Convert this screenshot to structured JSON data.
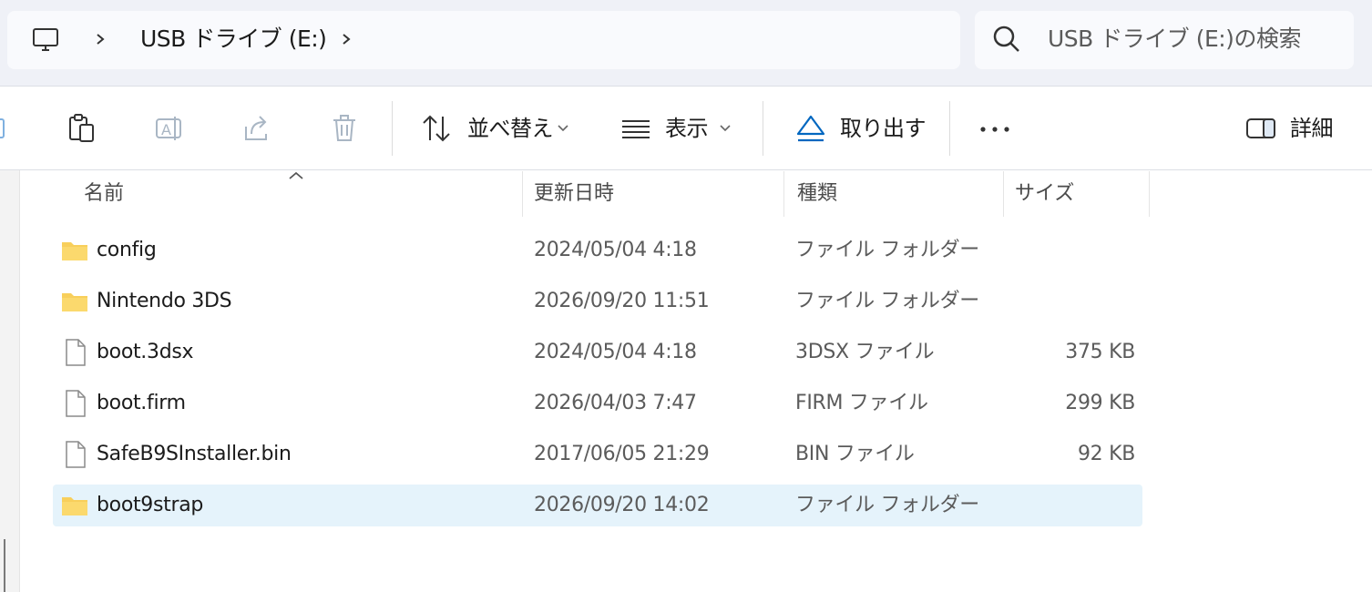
{
  "address": {
    "crumbs": [
      "USB ドライブ (E:)"
    ]
  },
  "search": {
    "placeholder": "USB ドライブ (E:)の検索"
  },
  "toolbar": {
    "sort_label": "並べ替え",
    "view_label": "表示",
    "eject_label": "取り出す",
    "details_label": "詳細"
  },
  "columns": {
    "name": "名前",
    "date": "更新日時",
    "type": "種類",
    "size": "サイズ"
  },
  "files": [
    {
      "name": "config",
      "date": "2024/05/04 4:18",
      "type": "ファイル フォルダー",
      "size": "",
      "icon": "folder-icon"
    },
    {
      "name": "Nintendo 3DS",
      "date": "2026/09/20 11:51",
      "type": "ファイル フォルダー",
      "size": "",
      "icon": "folder-icon"
    },
    {
      "name": "boot.3dsx",
      "date": "2024/05/04 4:18",
      "type": "3DSX ファイル",
      "size": "375 KB",
      "icon": "file-icon"
    },
    {
      "name": "boot.firm",
      "date": "2026/04/03 7:47",
      "type": "FIRM ファイル",
      "size": "299 KB",
      "icon": "file-icon"
    },
    {
      "name": "SafeB9SInstaller.bin",
      "date": "2017/06/05 21:29",
      "type": "BIN ファイル",
      "size": "92 KB",
      "icon": "file-icon"
    },
    {
      "name": "boot9strap",
      "date": "2026/09/20 14:02",
      "type": "ファイル フォルダー",
      "size": "",
      "icon": "folder-icon",
      "selected": true
    }
  ],
  "colors": {
    "accent": "#0067c0",
    "selection": "#e5f3fb",
    "folder": "#f8cf5b"
  }
}
